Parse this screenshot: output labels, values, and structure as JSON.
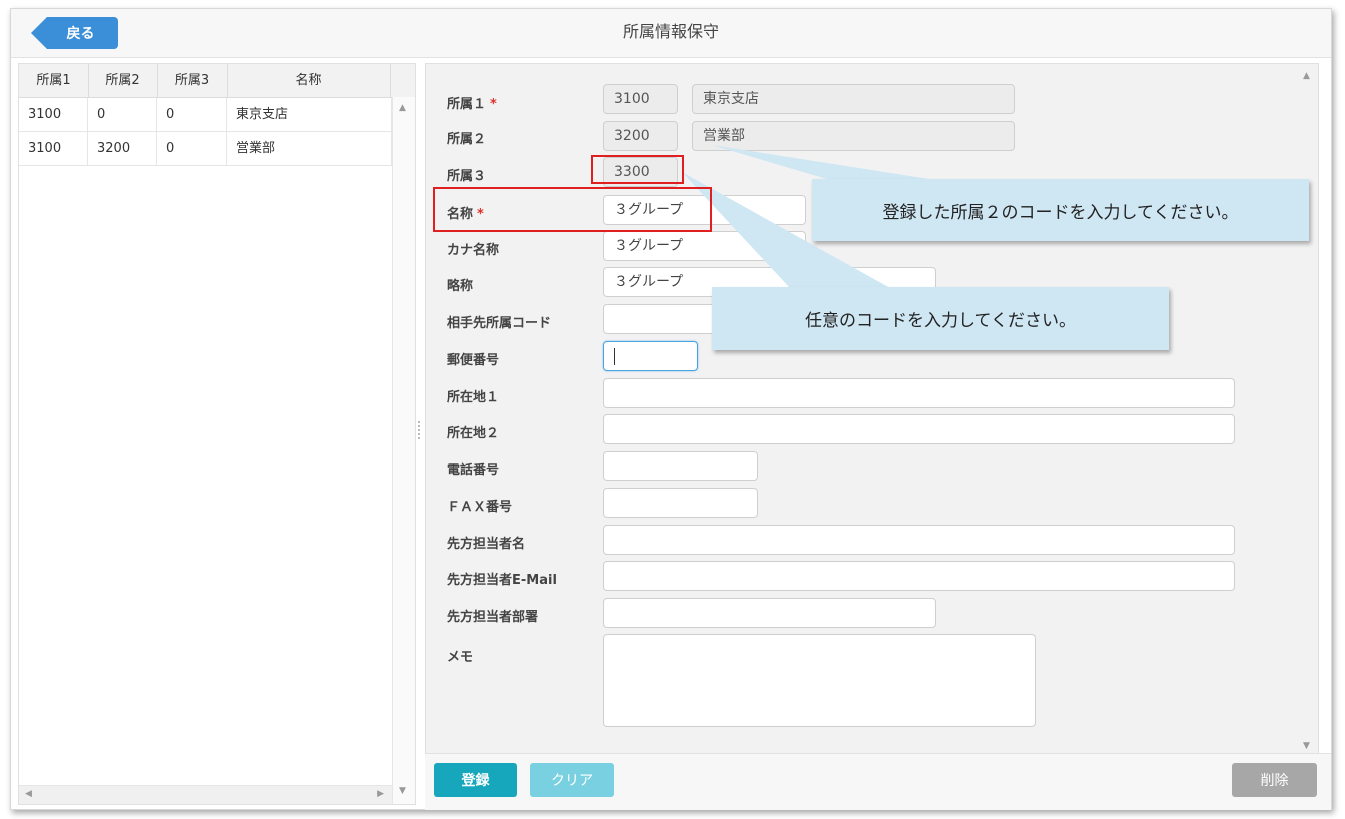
{
  "header": {
    "back_label": "戻る",
    "title": "所属情報保守"
  },
  "grid": {
    "columns": [
      "所属1",
      "所属2",
      "所属3",
      "名称"
    ],
    "rows": [
      [
        "3100",
        "0",
        "0",
        "東京支店"
      ],
      [
        "3100",
        "3200",
        "0",
        "営業部"
      ]
    ]
  },
  "form": {
    "labels": {
      "shozoku1": "所属１",
      "shozoku2": "所属２",
      "shozoku3": "所属３",
      "name": "名称",
      "kana": "カナ名称",
      "short": "略称",
      "partner_code": "相手先所属コード",
      "zip": "郵便番号",
      "address1": "所在地１",
      "address2": "所在地２",
      "tel": "電話番号",
      "fax": "ＦＡＸ番号",
      "contact_name": "先方担当者名",
      "contact_email": "先方担当者E-Mail",
      "contact_dept": "先方担当者部署",
      "memo": "メモ"
    },
    "required_mark": "*",
    "values": {
      "shozoku1_code": "3100",
      "shozoku1_name": "東京支店",
      "shozoku2_code": "3200",
      "shozoku2_name": "営業部",
      "shozoku3_code": "3300",
      "name": "３グループ",
      "kana": "３グループ",
      "short": "３グループ"
    }
  },
  "buttons": {
    "register": "登録",
    "clear": "クリア",
    "delete": "削除"
  },
  "callouts": {
    "c1": "登録した所属２のコードを入力してください。",
    "c2": "任意のコードを入力してください。"
  },
  "colors": {
    "accent": "#17a7bd",
    "back": "#3a8fd8",
    "annotation_red": "#e02020",
    "callout_bg": "#cfe6f3"
  }
}
